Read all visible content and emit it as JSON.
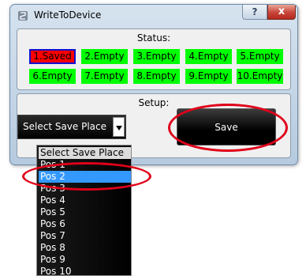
{
  "window": {
    "title": "WriteToDevice",
    "help_label": "?",
    "close_label": "x",
    "icon": "app-icon"
  },
  "status": {
    "title": "Status:",
    "slots": [
      {
        "label": "1.Saved",
        "state": "saved"
      },
      {
        "label": "2.Empty",
        "state": "empty"
      },
      {
        "label": "3.Empty",
        "state": "empty"
      },
      {
        "label": "4.Empty",
        "state": "empty"
      },
      {
        "label": "5.Empty",
        "state": "empty"
      },
      {
        "label": "6.Empty",
        "state": "empty"
      },
      {
        "label": "7.Empty",
        "state": "empty"
      },
      {
        "label": "8.Empty",
        "state": "empty"
      },
      {
        "label": "9.Empty",
        "state": "empty"
      },
      {
        "label": "10.Empty",
        "state": "empty"
      }
    ]
  },
  "setup": {
    "title": "Setup:",
    "dropdown_value": "Select Save Place",
    "save_label": "Save"
  },
  "dropdown_options": [
    "Select Save Place",
    "Pos 1",
    "Pos 2",
    "Pos 3",
    "Pos 4",
    "Pos 5",
    "Pos 6",
    "Pos 7",
    "Pos 8",
    "Pos 9",
    "Pos 10"
  ],
  "highlighted_option": "Pos 2",
  "colors": {
    "empty_slot": "#00ff00",
    "saved_slot": "#ff0000",
    "saved_border": "#1010d0",
    "highlight": "#3399ff",
    "annotation": "#e0001a"
  }
}
